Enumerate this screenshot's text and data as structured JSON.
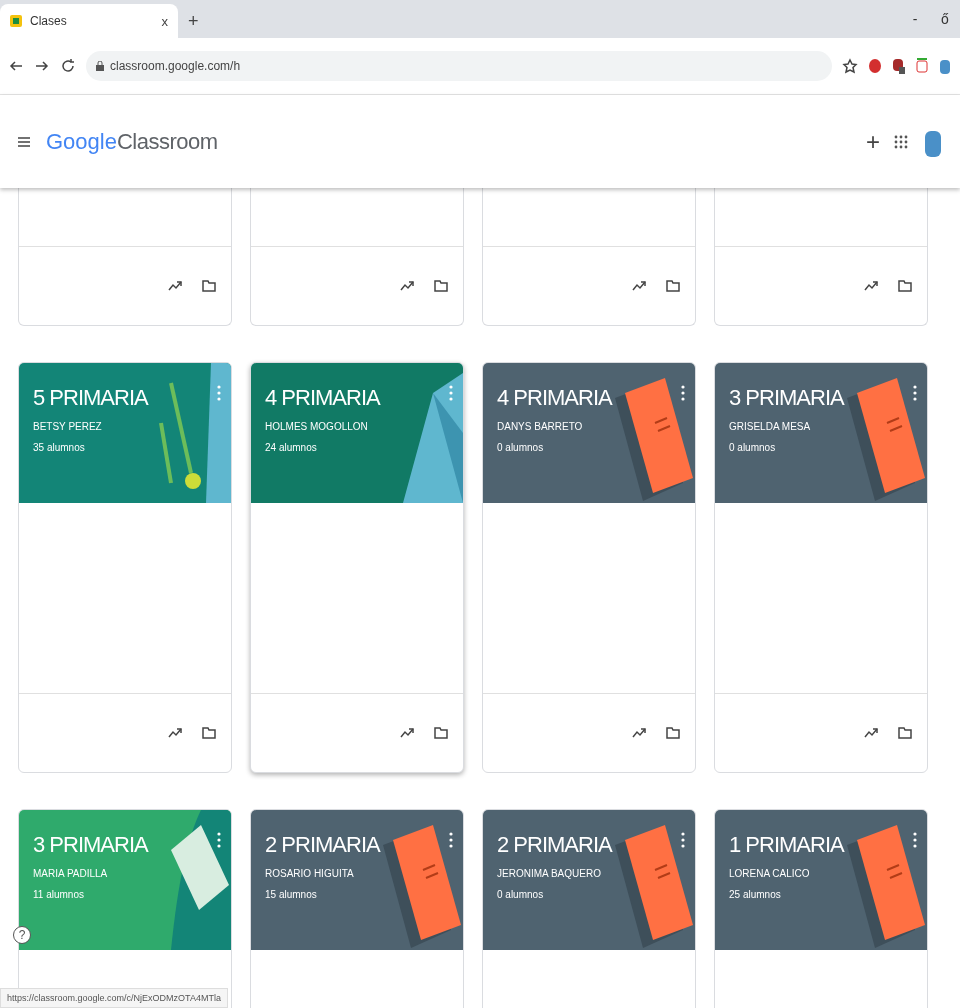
{
  "browser": {
    "tab": {
      "title": "Clases",
      "close": "x",
      "new_tab": "+"
    },
    "address": "classroom.google.com/h",
    "window_controls": [
      "-",
      "ő"
    ]
  },
  "header": {
    "logo_google": "Google",
    "logo_product": "Classroom",
    "add": "+"
  },
  "partial_cards": [
    {
      "kind": "blank"
    },
    {
      "kind": "blank"
    },
    {
      "kind": "blank"
    },
    {
      "kind": "blank"
    }
  ],
  "classes": [
    {
      "title": "5 PRIMARIA",
      "teacher": "BETSY PEREZ",
      "students": "35 alumnos",
      "color": "#138577",
      "kind": "plant",
      "raised": false
    },
    {
      "title": "4 PRIMARIA",
      "teacher": "HOLMES MOGOLLON",
      "students": "24 alumnos",
      "color": "#117a65",
      "kind": "pyramid",
      "raised": true
    },
    {
      "title": "4 PRIMARIA",
      "teacher": "DANYS BARRETO",
      "students": "0 alumnos",
      "color": "#4f6370",
      "kind": "notebook",
      "raised": false
    },
    {
      "title": "3 PRIMARIA",
      "teacher": "GRISELDA MESA",
      "students": "0 alumnos",
      "color": "#4f6370",
      "kind": "notebook",
      "raised": false
    },
    {
      "title": "3 PRIMARIA",
      "teacher": "MARIA PADILLA",
      "students": "11 alumnos",
      "color": "#2faa6c",
      "kind": "paper",
      "raised": false
    },
    {
      "title": "2 PRIMARIA",
      "teacher": "ROSARIO HIGUITA",
      "students": "15 alumnos",
      "color": "#4f6370",
      "kind": "notebook",
      "raised": false
    },
    {
      "title": "2 PRIMARIA",
      "teacher": "JERONIMA BAQUERO",
      "students": "0 alumnos",
      "color": "#4f6370",
      "kind": "notebook",
      "raised": false
    },
    {
      "title": "1 PRIMARIA",
      "teacher": "LORENA CALICO",
      "students": "25 alumnos",
      "color": "#4f6370",
      "kind": "notebook",
      "raised": false
    }
  ],
  "help": "?",
  "status_url": "https://classroom.google.com/c/NjExODMzOTA4MTla"
}
